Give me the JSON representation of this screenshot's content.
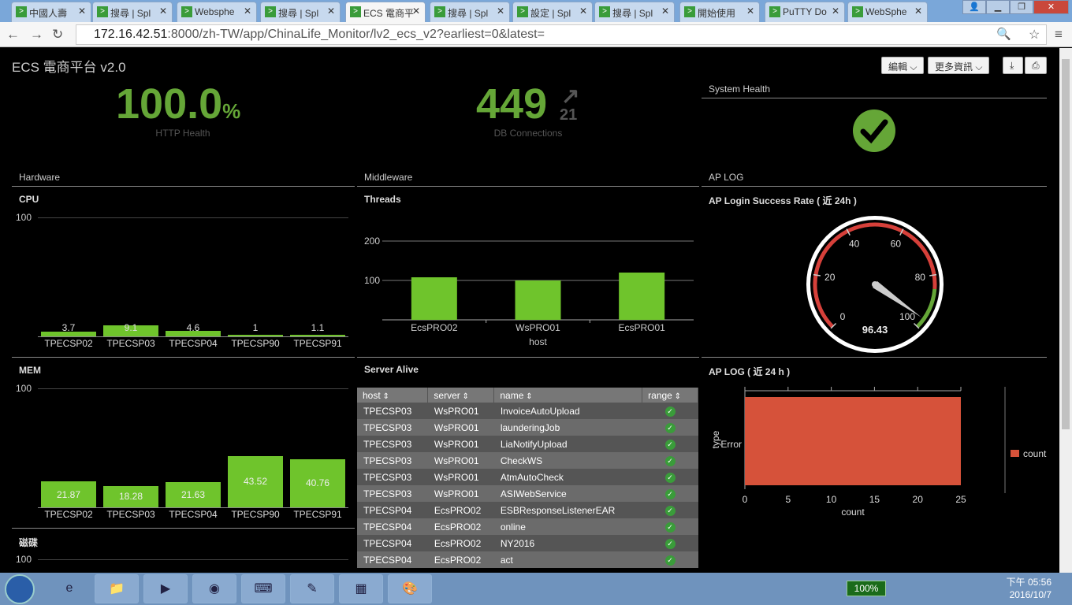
{
  "browser": {
    "tabs": [
      {
        "label": "中國人壽",
        "active": false
      },
      {
        "label": "搜尋 | Spl",
        "active": false
      },
      {
        "label": "Websphe",
        "active": false
      },
      {
        "label": "搜尋 | Spl",
        "active": false
      },
      {
        "label": "ECS 電商平",
        "active": true
      },
      {
        "label": "搜尋 | Spl",
        "active": false
      },
      {
        "label": "設定 | Spl",
        "active": false
      },
      {
        "label": "搜尋 | Spl",
        "active": false
      },
      {
        "label": "開始使用",
        "active": false
      },
      {
        "label": "PuTTY Do",
        "active": false
      },
      {
        "label": "WebSphe",
        "active": false
      }
    ],
    "url_host": "172.16.42.51",
    "url_rest": ":8000/zh-TW/app/ChinaLife_Monitor/lv2_ecs_v2?earliest=0&latest="
  },
  "dashboard": {
    "title": "ECS 電商平台 v2.0",
    "edit_label": "編輯",
    "more_label": "更多資訊",
    "http_health": {
      "value": "100.0",
      "unit": "%",
      "label": "HTTP Health"
    },
    "db_connections": {
      "value": "449",
      "delta": "21",
      "label": "DB Connections"
    },
    "system_health": {
      "label": "System Health"
    },
    "sections": {
      "hardware": "Hardware",
      "middleware": "Middleware",
      "aplog": "AP LOG"
    }
  },
  "cpu": {
    "title": "CPU",
    "ymax_label": "100",
    "chart_data": {
      "type": "bar",
      "categories": [
        "TPECSP02",
        "TPECSP03",
        "TPECSP04",
        "TPECSP90",
        "TPECSP91"
      ],
      "values": [
        3.7,
        9.1,
        4.6,
        1,
        1.1
      ],
      "ylim": [
        0,
        100
      ]
    }
  },
  "mem": {
    "title": "MEM",
    "ymax_label": "100",
    "chart_data": {
      "type": "bar",
      "categories": [
        "TPECSP02",
        "TPECSP03",
        "TPECSP04",
        "TPECSP90",
        "TPECSP91"
      ],
      "values": [
        21.87,
        18.28,
        21.63,
        43.52,
        40.76
      ],
      "ylim": [
        0,
        100
      ]
    }
  },
  "disk": {
    "title": "磁碟",
    "ymax_label": "100"
  },
  "threads": {
    "title": "Threads",
    "xlabel": "host",
    "ticks": [
      "200",
      "100"
    ],
    "chart_data": {
      "type": "bar",
      "categories": [
        "EcsPRO02",
        "WsPRO01",
        "EcsPRO01"
      ],
      "values": [
        108,
        100,
        120
      ],
      "ylim": [
        0,
        250
      ]
    }
  },
  "server_alive": {
    "title": "Server Alive",
    "columns": [
      "host",
      "server",
      "name",
      "range"
    ],
    "rows": [
      [
        "TPECSP03",
        "WsPRO01",
        "InvoiceAutoUpload"
      ],
      [
        "TPECSP03",
        "WsPRO01",
        "launderingJob"
      ],
      [
        "TPECSP03",
        "WsPRO01",
        "LiaNotifyUpload"
      ],
      [
        "TPECSP03",
        "WsPRO01",
        "CheckWS"
      ],
      [
        "TPECSP03",
        "WsPRO01",
        "AtmAutoCheck"
      ],
      [
        "TPECSP03",
        "WsPRO01",
        "ASIWebService"
      ],
      [
        "TPECSP04",
        "EcsPRO02",
        "ESBResponseListenerEAR"
      ],
      [
        "TPECSP04",
        "EcsPRO02",
        "online"
      ],
      [
        "TPECSP04",
        "EcsPRO02",
        "NY2016"
      ],
      [
        "TPECSP04",
        "EcsPRO02",
        "act"
      ]
    ]
  },
  "ap_login": {
    "title": "AP Login Success Rate ( 近 24h )",
    "value": "96.43",
    "ticks": [
      "0",
      "20",
      "40",
      "60",
      "80",
      "100"
    ],
    "gauge_value": 96.43
  },
  "ap_log": {
    "title": "AP LOG ( 近 24 h )",
    "ylabel": "type",
    "xlabel": "count",
    "legend": "count",
    "chart_data": {
      "type": "bar",
      "categories": [
        "Error"
      ],
      "values": [
        25
      ],
      "xlim": [
        0,
        25
      ],
      "xticks": [
        "0",
        "5",
        "10",
        "15",
        "20",
        "25"
      ]
    }
  },
  "taskbar": {
    "battery": "100%",
    "time": "下午 05:56",
    "date": "2016/10/7"
  },
  "colors": {
    "accent_green": "#65a637",
    "bar_green": "#6fc42c",
    "error_red": "#d6523a"
  }
}
